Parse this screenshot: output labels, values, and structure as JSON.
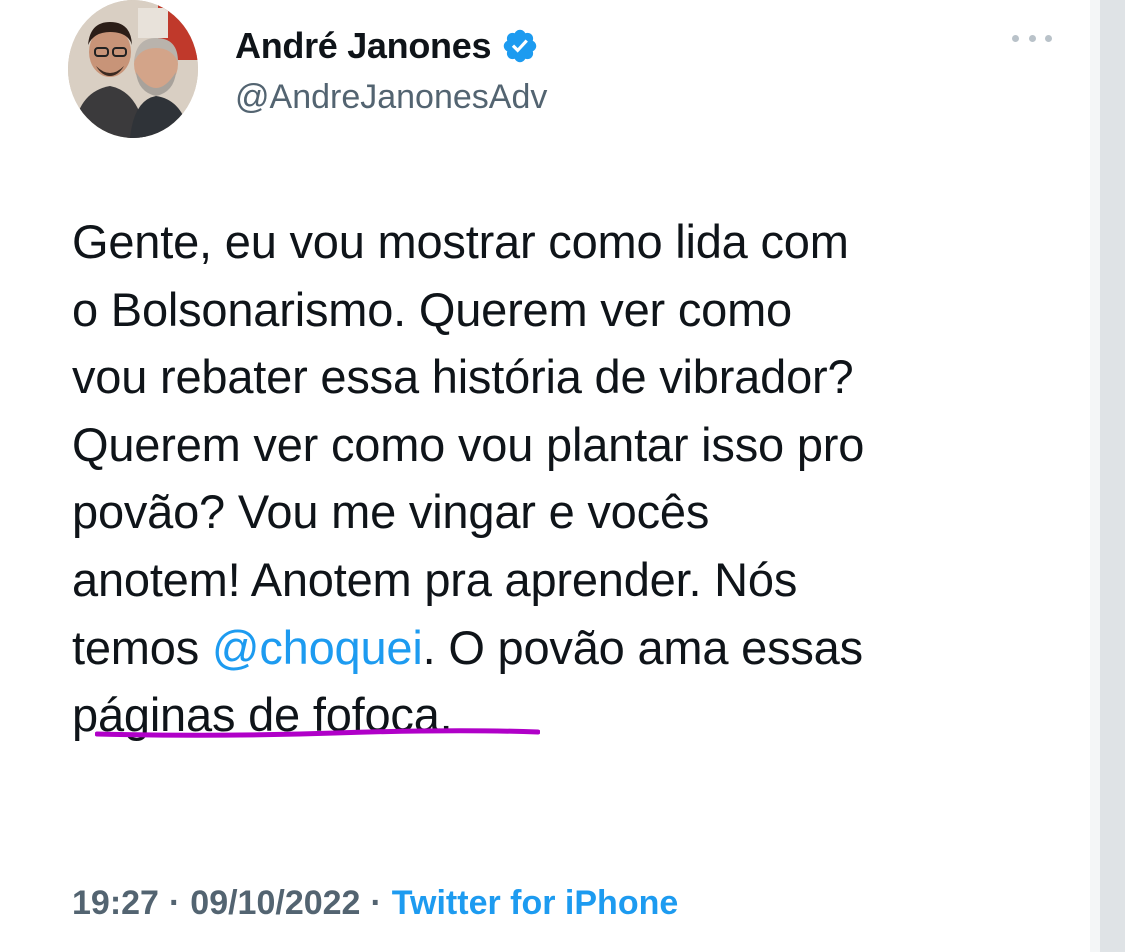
{
  "profile": {
    "display_name": "André Janones",
    "handle": "@AndreJanonesAdv"
  },
  "tweet": {
    "lines": [
      {
        "text": "Gente, eu vou mostrar como lida com"
      },
      {
        "text": "o Bolsonarismo. Querem ver como"
      },
      {
        "text": "vou rebater essa história de vibrador?"
      },
      {
        "text": "Querem ver como vou plantar isso pro"
      },
      {
        "text": "povão? Vou me vingar e vocês"
      },
      {
        "text": "anotem! Anotem pra aprender. Nós"
      },
      {
        "before": "temos ",
        "mention": "@choquei",
        "after": ". O povão ama essas"
      },
      {
        "text": "páginas de fofoca."
      }
    ]
  },
  "meta": {
    "time": "19:27",
    "separator": "·",
    "date": "09/10/2022",
    "source": "Twitter for iPhone"
  },
  "colors": {
    "link": "#1d9bf0",
    "text": "#0f1419",
    "muted": "#536471",
    "underline_annotation": "#b000c8"
  },
  "icons": {
    "verified": "verified-badge-icon",
    "more": "more-options-icon"
  }
}
